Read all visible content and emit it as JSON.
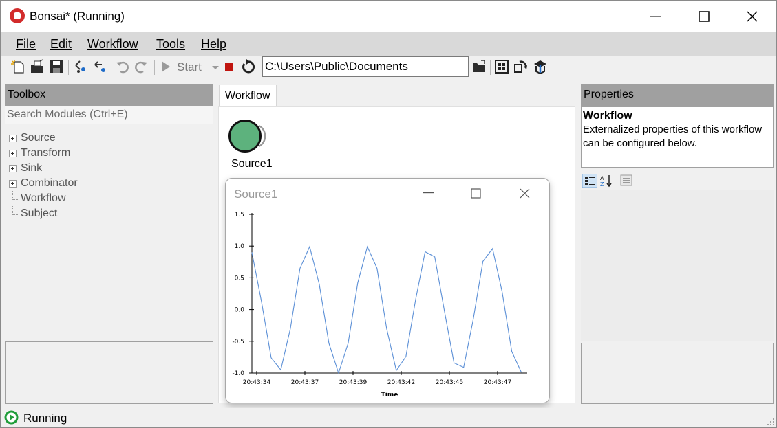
{
  "window": {
    "title": "Bonsai* (Running)",
    "controls": [
      "minimize",
      "maximize",
      "close"
    ]
  },
  "menu": {
    "items": [
      "File",
      "Edit",
      "Workflow",
      "Tools",
      "Help"
    ]
  },
  "toolbar": {
    "start_label": "Start",
    "path_value": "C:\\Users\\Public\\Documents",
    "icons": [
      "new-file-icon",
      "open-icon",
      "save-icon",
      "group-icon",
      "ungroup-icon",
      "undo-icon",
      "redo-icon",
      "start-icon",
      "start-dropdown-icon",
      "stop-icon",
      "restart-icon",
      "browse-folder-icon",
      "gallery-icon",
      "reload-icon",
      "package-manager-icon"
    ],
    "colors": {
      "stop": "#c0150f",
      "disabled": "#9a9a9a"
    }
  },
  "toolbox": {
    "header": "Toolbox",
    "search_placeholder": "Search Modules (Ctrl+E)",
    "items": [
      {
        "label": "Source",
        "expandable": true
      },
      {
        "label": "Transform",
        "expandable": true
      },
      {
        "label": "Sink",
        "expandable": true
      },
      {
        "label": "Combinator",
        "expandable": true
      },
      {
        "label": "Workflow",
        "expandable": false
      },
      {
        "label": "Subject",
        "expandable": false
      }
    ]
  },
  "workflow": {
    "tab_label": "Workflow",
    "node": {
      "label": "Source1",
      "color": "#5db27d"
    }
  },
  "visualizer": {
    "title": "Source1",
    "controls": [
      "minimize",
      "maximize",
      "close"
    ]
  },
  "chart_data": {
    "type": "line",
    "title": "",
    "xlabel": "Time",
    "ylabel": "",
    "x_ticks": [
      "20:43:34",
      "20:43:37",
      "20:43:39",
      "20:43:42",
      "20:43:45",
      "20:43:47"
    ],
    "y_ticks": [
      "1.5",
      "1.0",
      "0.5",
      "0.0",
      "-0.5",
      "-1.0"
    ],
    "ylim": [
      -1.0,
      1.5
    ],
    "xlim": [
      0,
      14.3
    ],
    "grid": false,
    "legend": "none",
    "series": [
      {
        "color": "#5b8fd6",
        "x": [
          0,
          0.5,
          1.0,
          1.5,
          2.0,
          2.5,
          3.0,
          3.5,
          4.0,
          4.5,
          5.0,
          5.5,
          6.0,
          6.5,
          7.0,
          7.5,
          8.0,
          8.5,
          9.0,
          9.5,
          10.0,
          10.5,
          11.0,
          11.5,
          12.0,
          12.5,
          13.0,
          13.5,
          14.0
        ],
        "y": [
          0.9,
          0.12,
          -0.76,
          -0.95,
          -0.3,
          0.65,
          0.99,
          0.4,
          -0.53,
          -1.0,
          -0.53,
          0.42,
          0.99,
          0.65,
          -0.3,
          -0.96,
          -0.74,
          0.15,
          0.91,
          0.83,
          -0.02,
          -0.84,
          -0.91,
          -0.15,
          0.76,
          0.96,
          0.28,
          -0.66,
          -0.99
        ]
      }
    ]
  },
  "properties": {
    "header": "Properties",
    "desc_title": "Workflow",
    "desc_text": "Externalized properties of this workflow can be configured below.",
    "icons": [
      "categorized-icon",
      "alphabetical-icon",
      "property-pages-icon"
    ]
  },
  "status": {
    "text": "Running",
    "color": "#1f9d3a"
  }
}
